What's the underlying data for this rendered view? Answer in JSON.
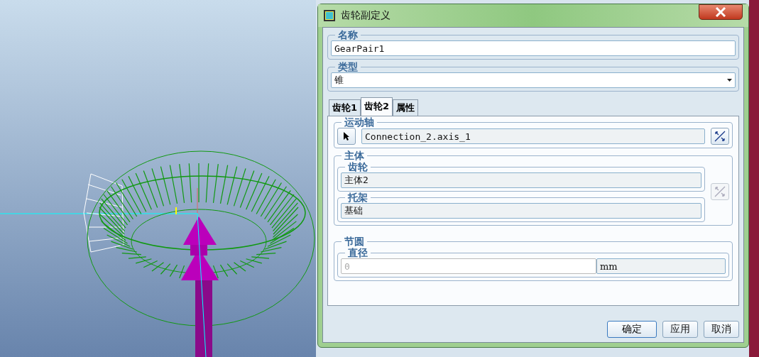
{
  "window": {
    "title": "齿轮副定义"
  },
  "name": {
    "label": "名称",
    "value": "GearPair1"
  },
  "type": {
    "label": "类型",
    "value": "锥"
  },
  "tabs": [
    {
      "label": "齿轮1",
      "selected": false
    },
    {
      "label": "齿轮2",
      "selected": true
    },
    {
      "label": "属性",
      "selected": false
    }
  ],
  "motion_axis": {
    "label": "运动轴",
    "value": "Connection_2.axis_1",
    "flip_disabled": false
  },
  "body": {
    "label": "主体",
    "gear": {
      "label": "齿轮",
      "value": "主体2"
    },
    "carrier": {
      "label": "托架",
      "value": "基础"
    },
    "flip_disabled": true
  },
  "pitch_circle": {
    "label": "节圆",
    "diameter": {
      "label": "直径",
      "value": "0",
      "disabled": true
    },
    "unit": "mm"
  },
  "buttons": [
    {
      "label": "确定",
      "default": true
    },
    {
      "label": "应用",
      "default": false
    },
    {
      "label": "取消",
      "default": false
    }
  ]
}
